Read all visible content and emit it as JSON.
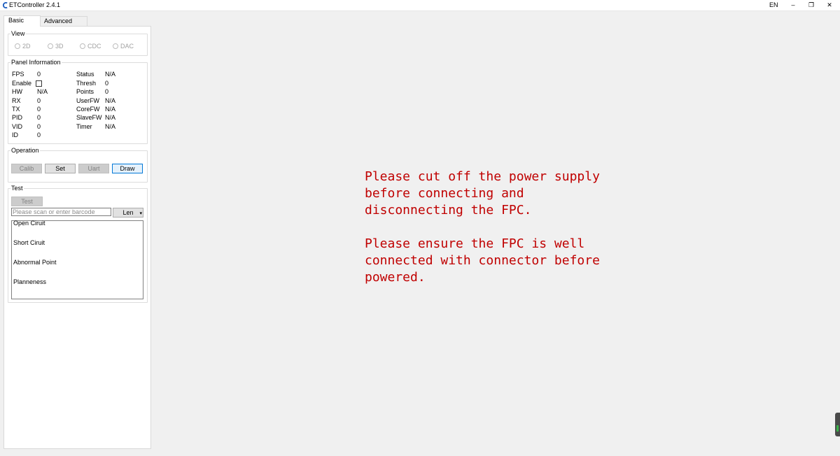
{
  "window": {
    "title": "ETController 2.4.1",
    "language": "EN",
    "min_glyph": "–",
    "max_glyph": "❐",
    "close_glyph": "✕"
  },
  "tabs": [
    {
      "label": "Basic",
      "active": true
    },
    {
      "label": "Advanced",
      "active": false
    }
  ],
  "view": {
    "title": "View",
    "options": [
      "2D",
      "3D",
      "CDC",
      "DAC"
    ]
  },
  "panel_info": {
    "title": "Panel Information",
    "left": [
      {
        "label": "FPS",
        "value": "0"
      },
      {
        "label": "Enable",
        "value": ""
      },
      {
        "label": "HW",
        "value": "N/A"
      },
      {
        "label": "RX",
        "value": "0"
      },
      {
        "label": "TX",
        "value": "0"
      },
      {
        "label": "PID",
        "value": "0"
      },
      {
        "label": "VID",
        "value": "0"
      },
      {
        "label": "ID",
        "value": "0"
      }
    ],
    "right": [
      {
        "label": "Status",
        "value": "N/A"
      },
      {
        "label": "Thresh",
        "value": "0"
      },
      {
        "label": "Points",
        "value": "0"
      },
      {
        "label": "UserFW",
        "value": "N/A"
      },
      {
        "label": "CoreFW",
        "value": "N/A"
      },
      {
        "label": "SlaveFW",
        "value": "N/A"
      },
      {
        "label": "Timer",
        "value": "N/A"
      }
    ]
  },
  "operation": {
    "title": "Operation",
    "buttons": [
      {
        "label": "Calib",
        "enabled": false
      },
      {
        "label": "Set",
        "enabled": true
      },
      {
        "label": "Uart",
        "enabled": false
      },
      {
        "label": "Draw",
        "enabled": true
      }
    ]
  },
  "test": {
    "title": "Test",
    "test_button": "Test",
    "barcode_placeholder": "Please scan or enter barcode",
    "len_button": "Len",
    "len_arrow": "▾",
    "results": [
      "Open Ciruit",
      "Short Ciruit",
      "Abnormal Point",
      "Planneness"
    ]
  },
  "notice": {
    "text": "Please cut off the power supply\nbefore connecting and\ndisconnecting the FPC.\n\nPlease ensure the FPC is well\nconnected with connector before\npowered.",
    "color": "#c00000"
  }
}
